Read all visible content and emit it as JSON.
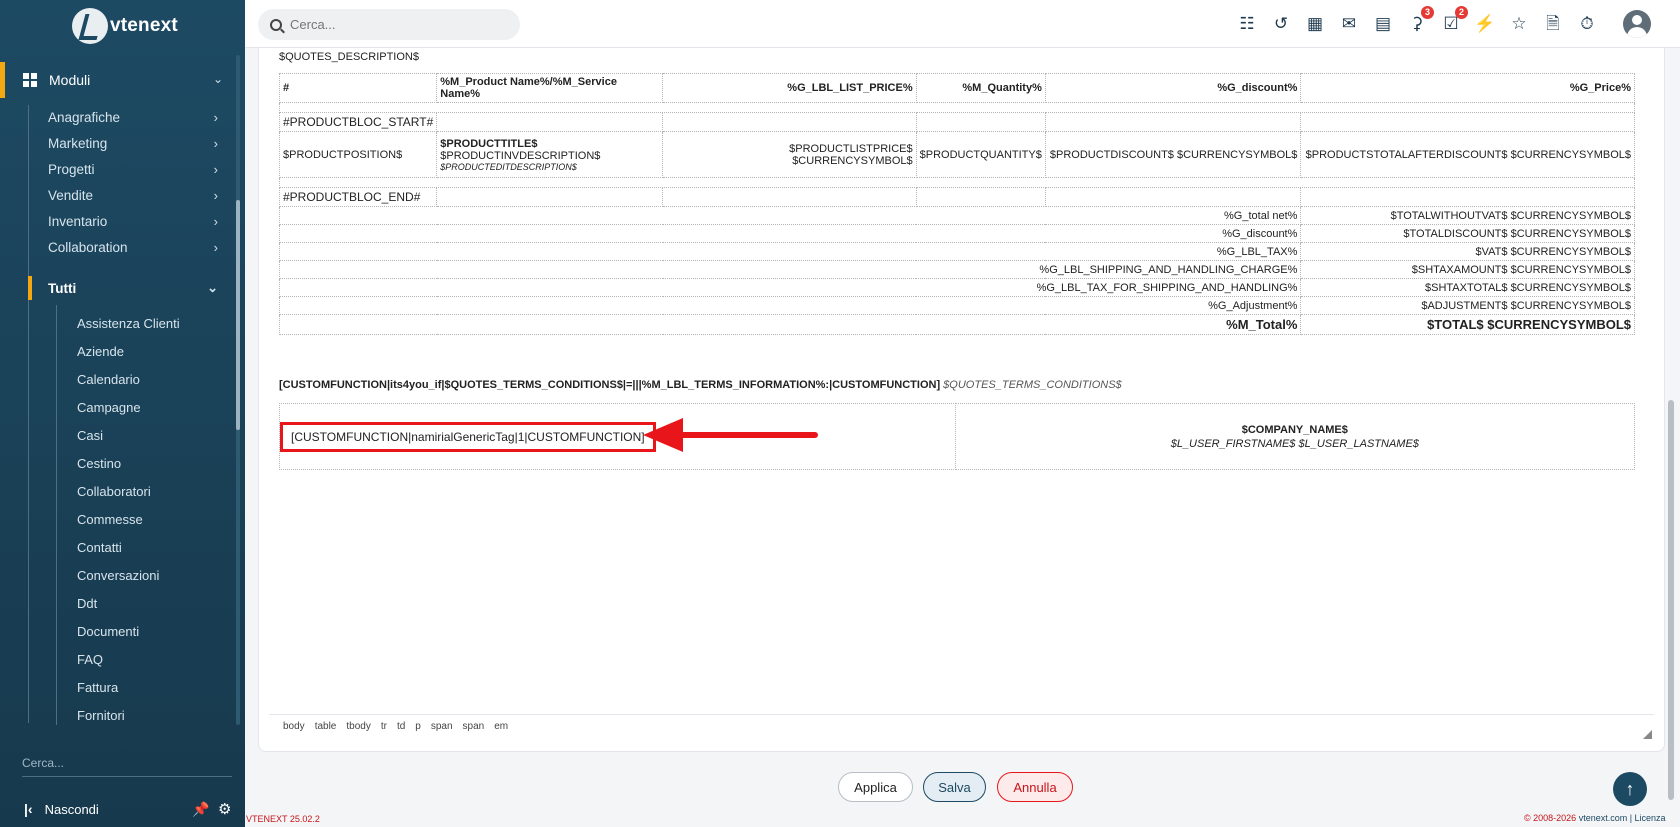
{
  "app": {
    "logo_text": "vtenext",
    "version": "VTENEXT 25.02.2",
    "copyright": "© 2008-2026",
    "copyright_link": "vtenext.com | Licenza"
  },
  "search": {
    "placeholder": "Cerca..."
  },
  "sidebar": {
    "section": "Moduli",
    "items": [
      {
        "label": "Anagrafiche"
      },
      {
        "label": "Marketing"
      },
      {
        "label": "Progetti"
      },
      {
        "label": "Vendite"
      },
      {
        "label": "Inventario"
      },
      {
        "label": "Collaboration"
      },
      {
        "label": "Tutti"
      }
    ],
    "sub_items": [
      "Assistenza Clienti",
      "Aziende",
      "Calendario",
      "Campagne",
      "Casi",
      "Cestino",
      "Collaboratori",
      "Commesse",
      "Contatti",
      "Conversazioni",
      "Ddt",
      "Documenti",
      "FAQ",
      "Fattura",
      "Fornitori"
    ],
    "search_placeholder": "Cerca...",
    "hide_label": "Nascondi"
  },
  "topbar": {
    "notifications_count": "3",
    "todo_count": "2"
  },
  "doc": {
    "description_tag": "$QUOTES_DESCRIPTION$",
    "headers": [
      "#",
      "%M_Product Name%/%M_Service Name%",
      "%G_LBL_LIST_PRICE%",
      "%M_Quantity%",
      "%G_discount%",
      "%G_Price%"
    ],
    "bloc_start": "#PRODUCTBLOC_START#",
    "bloc_end": "#PRODUCTBLOC_END#",
    "row": {
      "position": "$PRODUCTPOSITION$",
      "title": "$PRODUCTTITLE$",
      "inv_desc": "$PRODUCTINVDESCRIPTION$",
      "edit_desc": "$PRODUCTEDITDESCRIPTION$",
      "list_price": "$PRODUCTLISTPRICE$ $CURRENCYSYMBOL$",
      "quantity": "$PRODUCTQUANTITY$",
      "discount": "$PRODUCTDISCOUNT$ $CURRENCYSYMBOL$",
      "total": "$PRODUCTSTOTALAFTERDISCOUNT$ $CURRENCYSYMBOL$"
    },
    "totals": [
      {
        "label": "%G_total net%",
        "value": "$TOTALWITHOUTVAT$ $CURRENCYSYMBOL$"
      },
      {
        "label": "%G_discount%",
        "value": "$TOTALDISCOUNT$ $CURRENCYSYMBOL$"
      },
      {
        "label": "%G_LBL_TAX%",
        "value": "$VAT$ $CURRENCYSYMBOL$"
      },
      {
        "label": "%G_LBL_SHIPPING_AND_HANDLING_CHARGE%",
        "value": "$SHTAXAMOUNT$ $CURRENCYSYMBOL$"
      },
      {
        "label": "%G_LBL_TAX_FOR_SHIPPING_AND_HANDLING%",
        "value": "$SHTAXTOTAL$ $CURRENCYSYMBOL$"
      },
      {
        "label": "%G_Adjustment%",
        "value": "$ADJUSTMENT$ $CURRENCYSYMBOL$"
      }
    ],
    "grand_total": {
      "label": "%M_Total%",
      "value": "$TOTAL$ $CURRENCYSYMBOL$"
    },
    "terms_bold": "[CUSTOMFUNCTION|its4you_if|$QUOTES_TERMS_CONDITIONS$|=|||%M_LBL_TERMS_INFORMATION%:|CUSTOMFUNCTION]",
    "terms_italic": "$QUOTES_TERMS_CONDITIONS$",
    "custom_function": "[CUSTOMFUNCTION|namirialGenericTag|1|CUSTOMFUNCTION]",
    "company_name": "$COMPANY_NAME$",
    "user_names": "$L_USER_FIRSTNAME$ $L_USER_LASTNAME$"
  },
  "pathbar": [
    "body",
    "table",
    "tbody",
    "tr",
    "td",
    "p",
    "span",
    "span",
    "em"
  ],
  "buttons": {
    "apply": "Applica",
    "save": "Salva",
    "cancel": "Annulla"
  },
  "colors": {
    "sidebar": "#1d4a63",
    "accent": "#f3a712",
    "highlight": "#e8161b"
  }
}
